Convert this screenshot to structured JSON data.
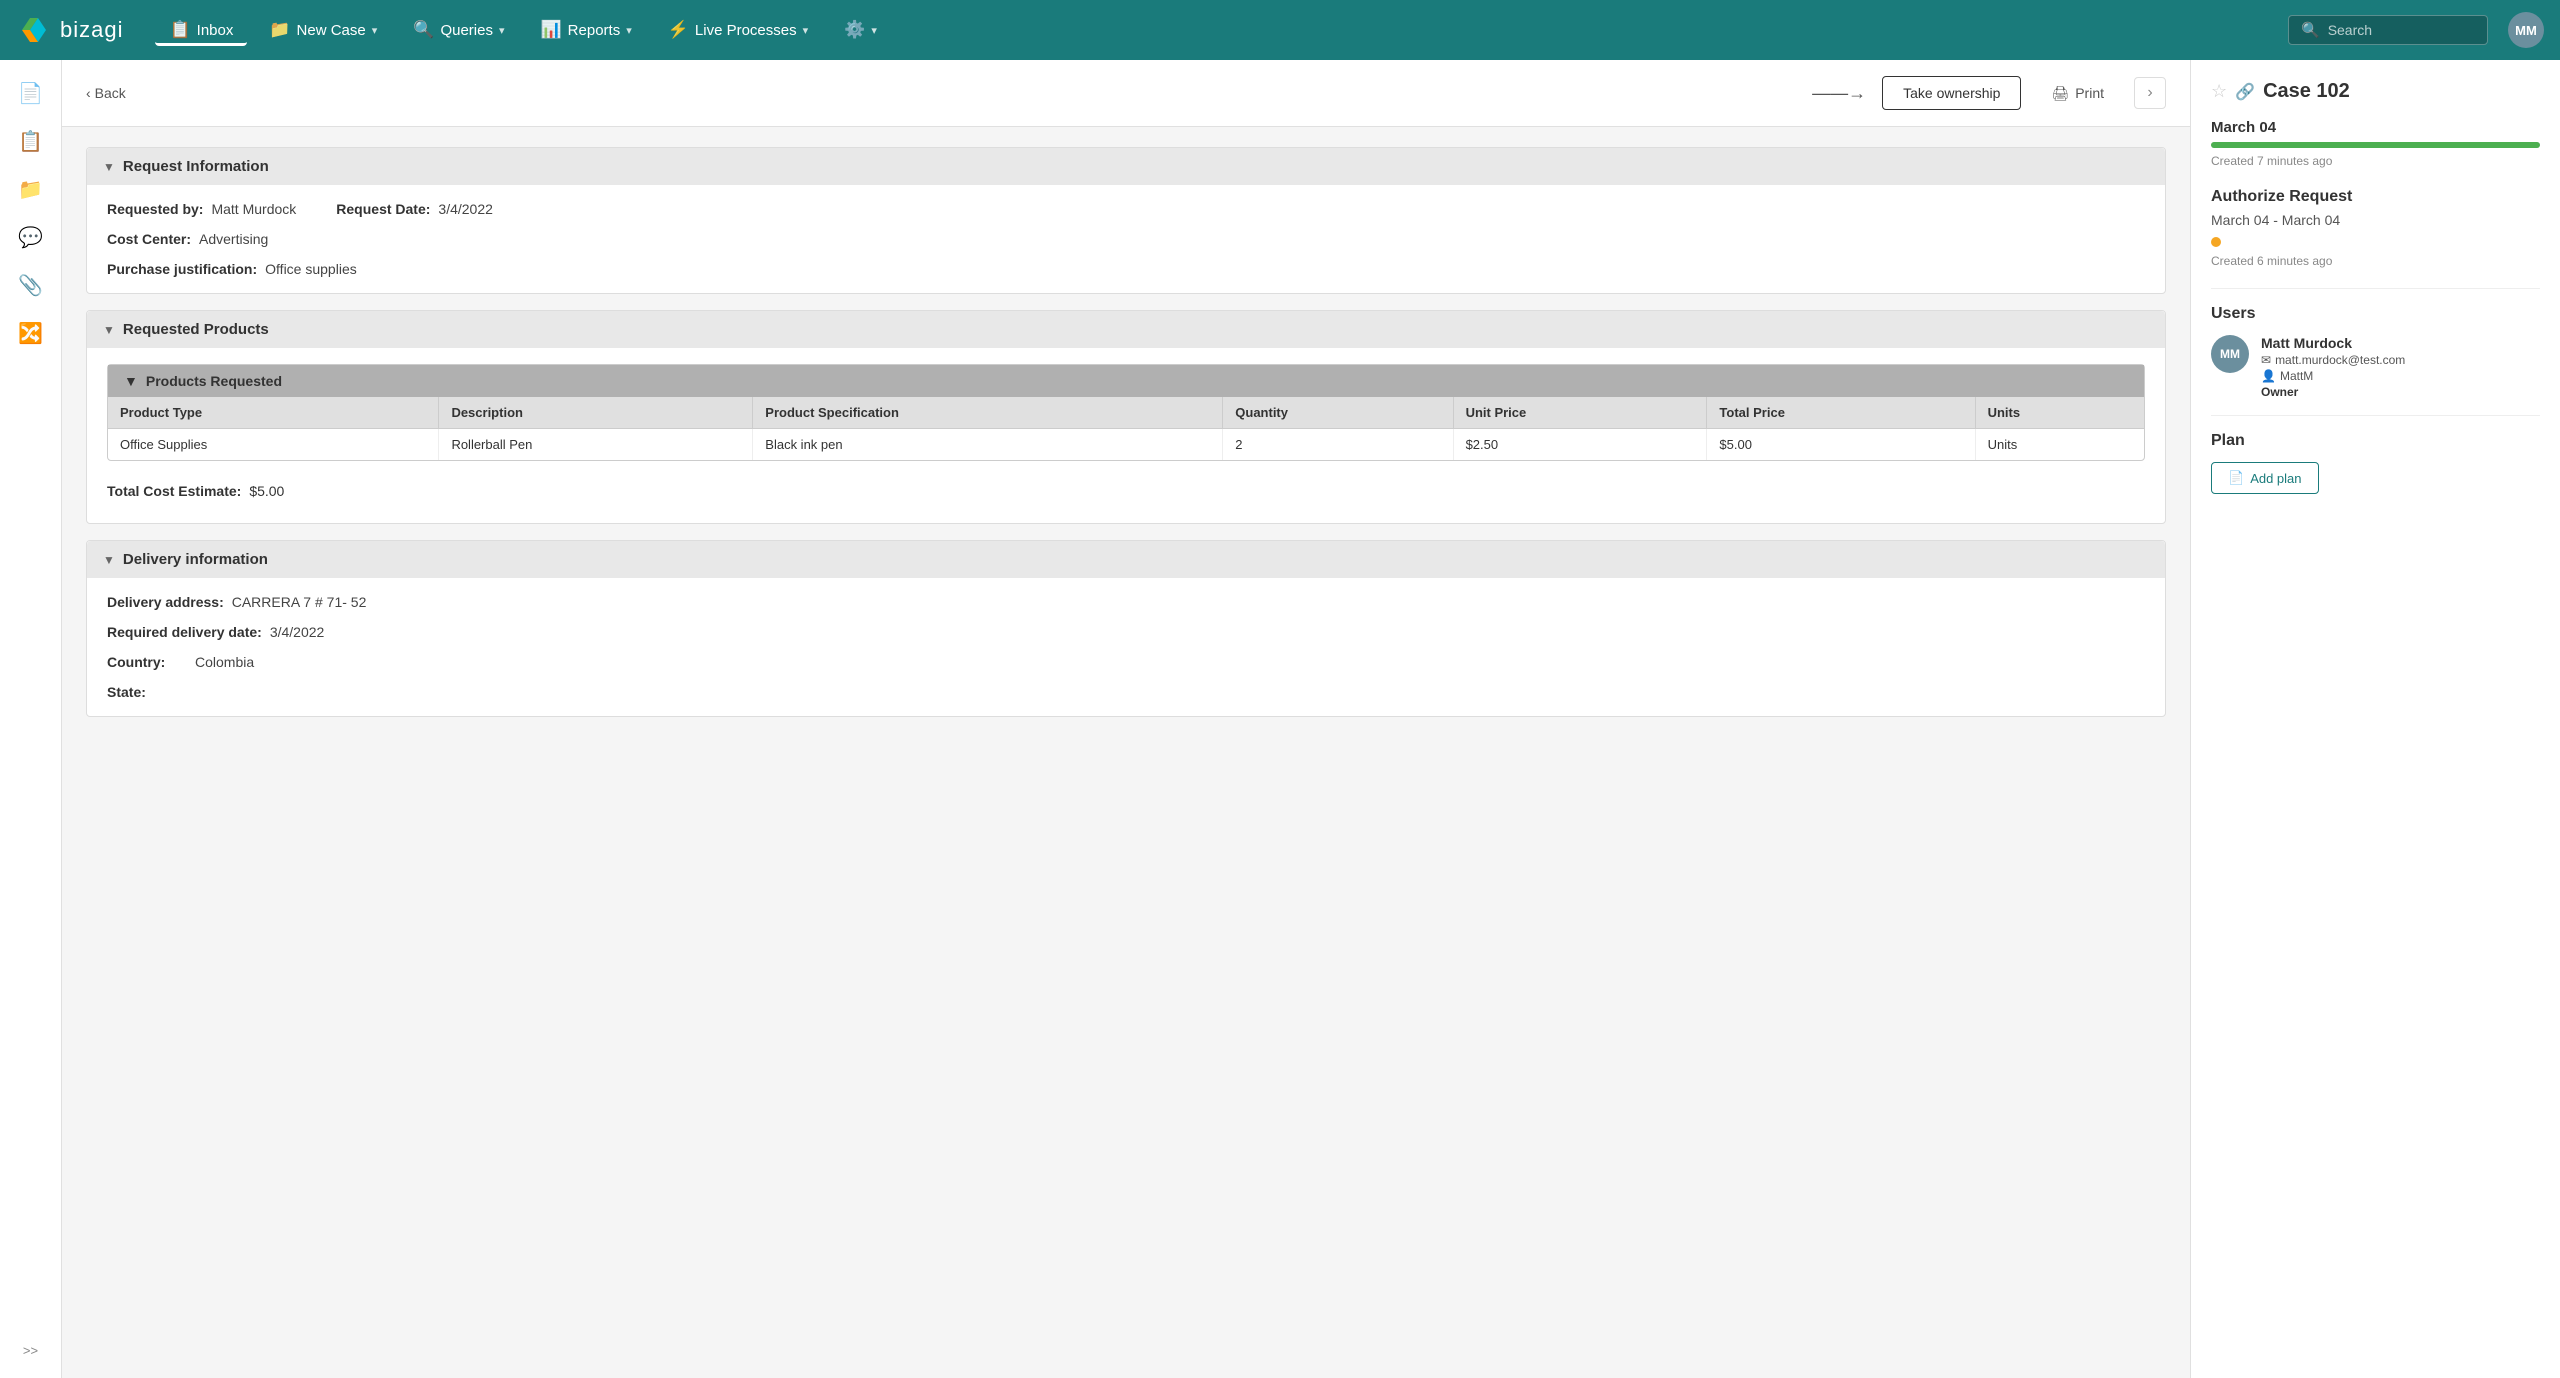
{
  "nav": {
    "logo_text": "bizagi",
    "items": [
      {
        "id": "inbox",
        "label": "Inbox",
        "icon": "📋",
        "active": true,
        "has_arrow": false
      },
      {
        "id": "new-case",
        "label": "New Case",
        "icon": "📁",
        "active": false,
        "has_arrow": true
      },
      {
        "id": "queries",
        "label": "Queries",
        "icon": "🔍",
        "active": false,
        "has_arrow": true
      },
      {
        "id": "reports",
        "label": "Reports",
        "icon": "📊",
        "active": false,
        "has_arrow": true
      },
      {
        "id": "live-processes",
        "label": "Live Processes",
        "icon": "⚡",
        "active": false,
        "has_arrow": true
      },
      {
        "id": "settings",
        "label": "",
        "icon": "⚙️",
        "active": false,
        "has_arrow": true
      }
    ],
    "search_placeholder": "Search",
    "user_initials": "MM"
  },
  "sidebar": {
    "icons": [
      {
        "id": "document1",
        "icon": "📄"
      },
      {
        "id": "document2",
        "icon": "📋"
      },
      {
        "id": "folder",
        "icon": "📁"
      },
      {
        "id": "chat",
        "icon": "💬"
      },
      {
        "id": "attachment",
        "icon": "📎"
      },
      {
        "id": "network",
        "icon": "🔀"
      }
    ],
    "expand_label": ">>"
  },
  "toolbar": {
    "back_label": "Back",
    "take_ownership_label": "Take ownership",
    "print_label": "Print"
  },
  "form": {
    "sections": [
      {
        "id": "request-information",
        "title": "Request Information",
        "fields": [
          {
            "label": "Requested by:",
            "value": "Matt Murdock",
            "col": 1
          },
          {
            "label": "Request Date:",
            "value": "3/4/2022",
            "col": 2
          },
          {
            "label": "Cost Center:",
            "value": "Advertising",
            "col": 1
          },
          {
            "label": "Purchase justification:",
            "value": "Office supplies",
            "col": 1
          }
        ]
      },
      {
        "id": "requested-products",
        "title": "Requested Products",
        "sub_section": {
          "title": "Products Requested",
          "columns": [
            "Product Type",
            "Description",
            "Product Specification",
            "Quantity",
            "Unit Price",
            "Total Price",
            "Units"
          ],
          "rows": [
            {
              "product_type": "Office Supplies",
              "description": "Rollerball Pen",
              "specification": "Black ink pen",
              "quantity": "2",
              "unit_price": "$2.50",
              "total_price": "$5.00",
              "units": "Units"
            }
          ]
        },
        "total_label": "Total Cost Estimate:",
        "total_value": "$5.00"
      },
      {
        "id": "delivery-information",
        "title": "Delivery information",
        "fields": [
          {
            "label": "Delivery address:",
            "value": "CARRERA 7 # 71- 52",
            "col": 1
          },
          {
            "label": "Required delivery date:",
            "value": "3/4/2022",
            "col": 1
          },
          {
            "label": "Country:",
            "value": "Colombia",
            "col": 1
          },
          {
            "label": "State:",
            "value": "",
            "col": 1
          }
        ]
      }
    ]
  },
  "right_panel": {
    "case_title": "Case 102",
    "timeline": {
      "date": "March 04",
      "progress_percent": 100,
      "meta": "Created 7 minutes ago"
    },
    "authorize": {
      "title": "Authorize Request",
      "dates": "March 04 - March 04",
      "status_color": "#f5a623",
      "meta": "Created 6 minutes ago"
    },
    "users_title": "Users",
    "user": {
      "initials": "MM",
      "name": "Matt Murdock",
      "email": "matt.murdock@test.com",
      "username": "MattM",
      "role": "Owner"
    },
    "plan_title": "Plan",
    "add_plan_label": "Add plan"
  }
}
